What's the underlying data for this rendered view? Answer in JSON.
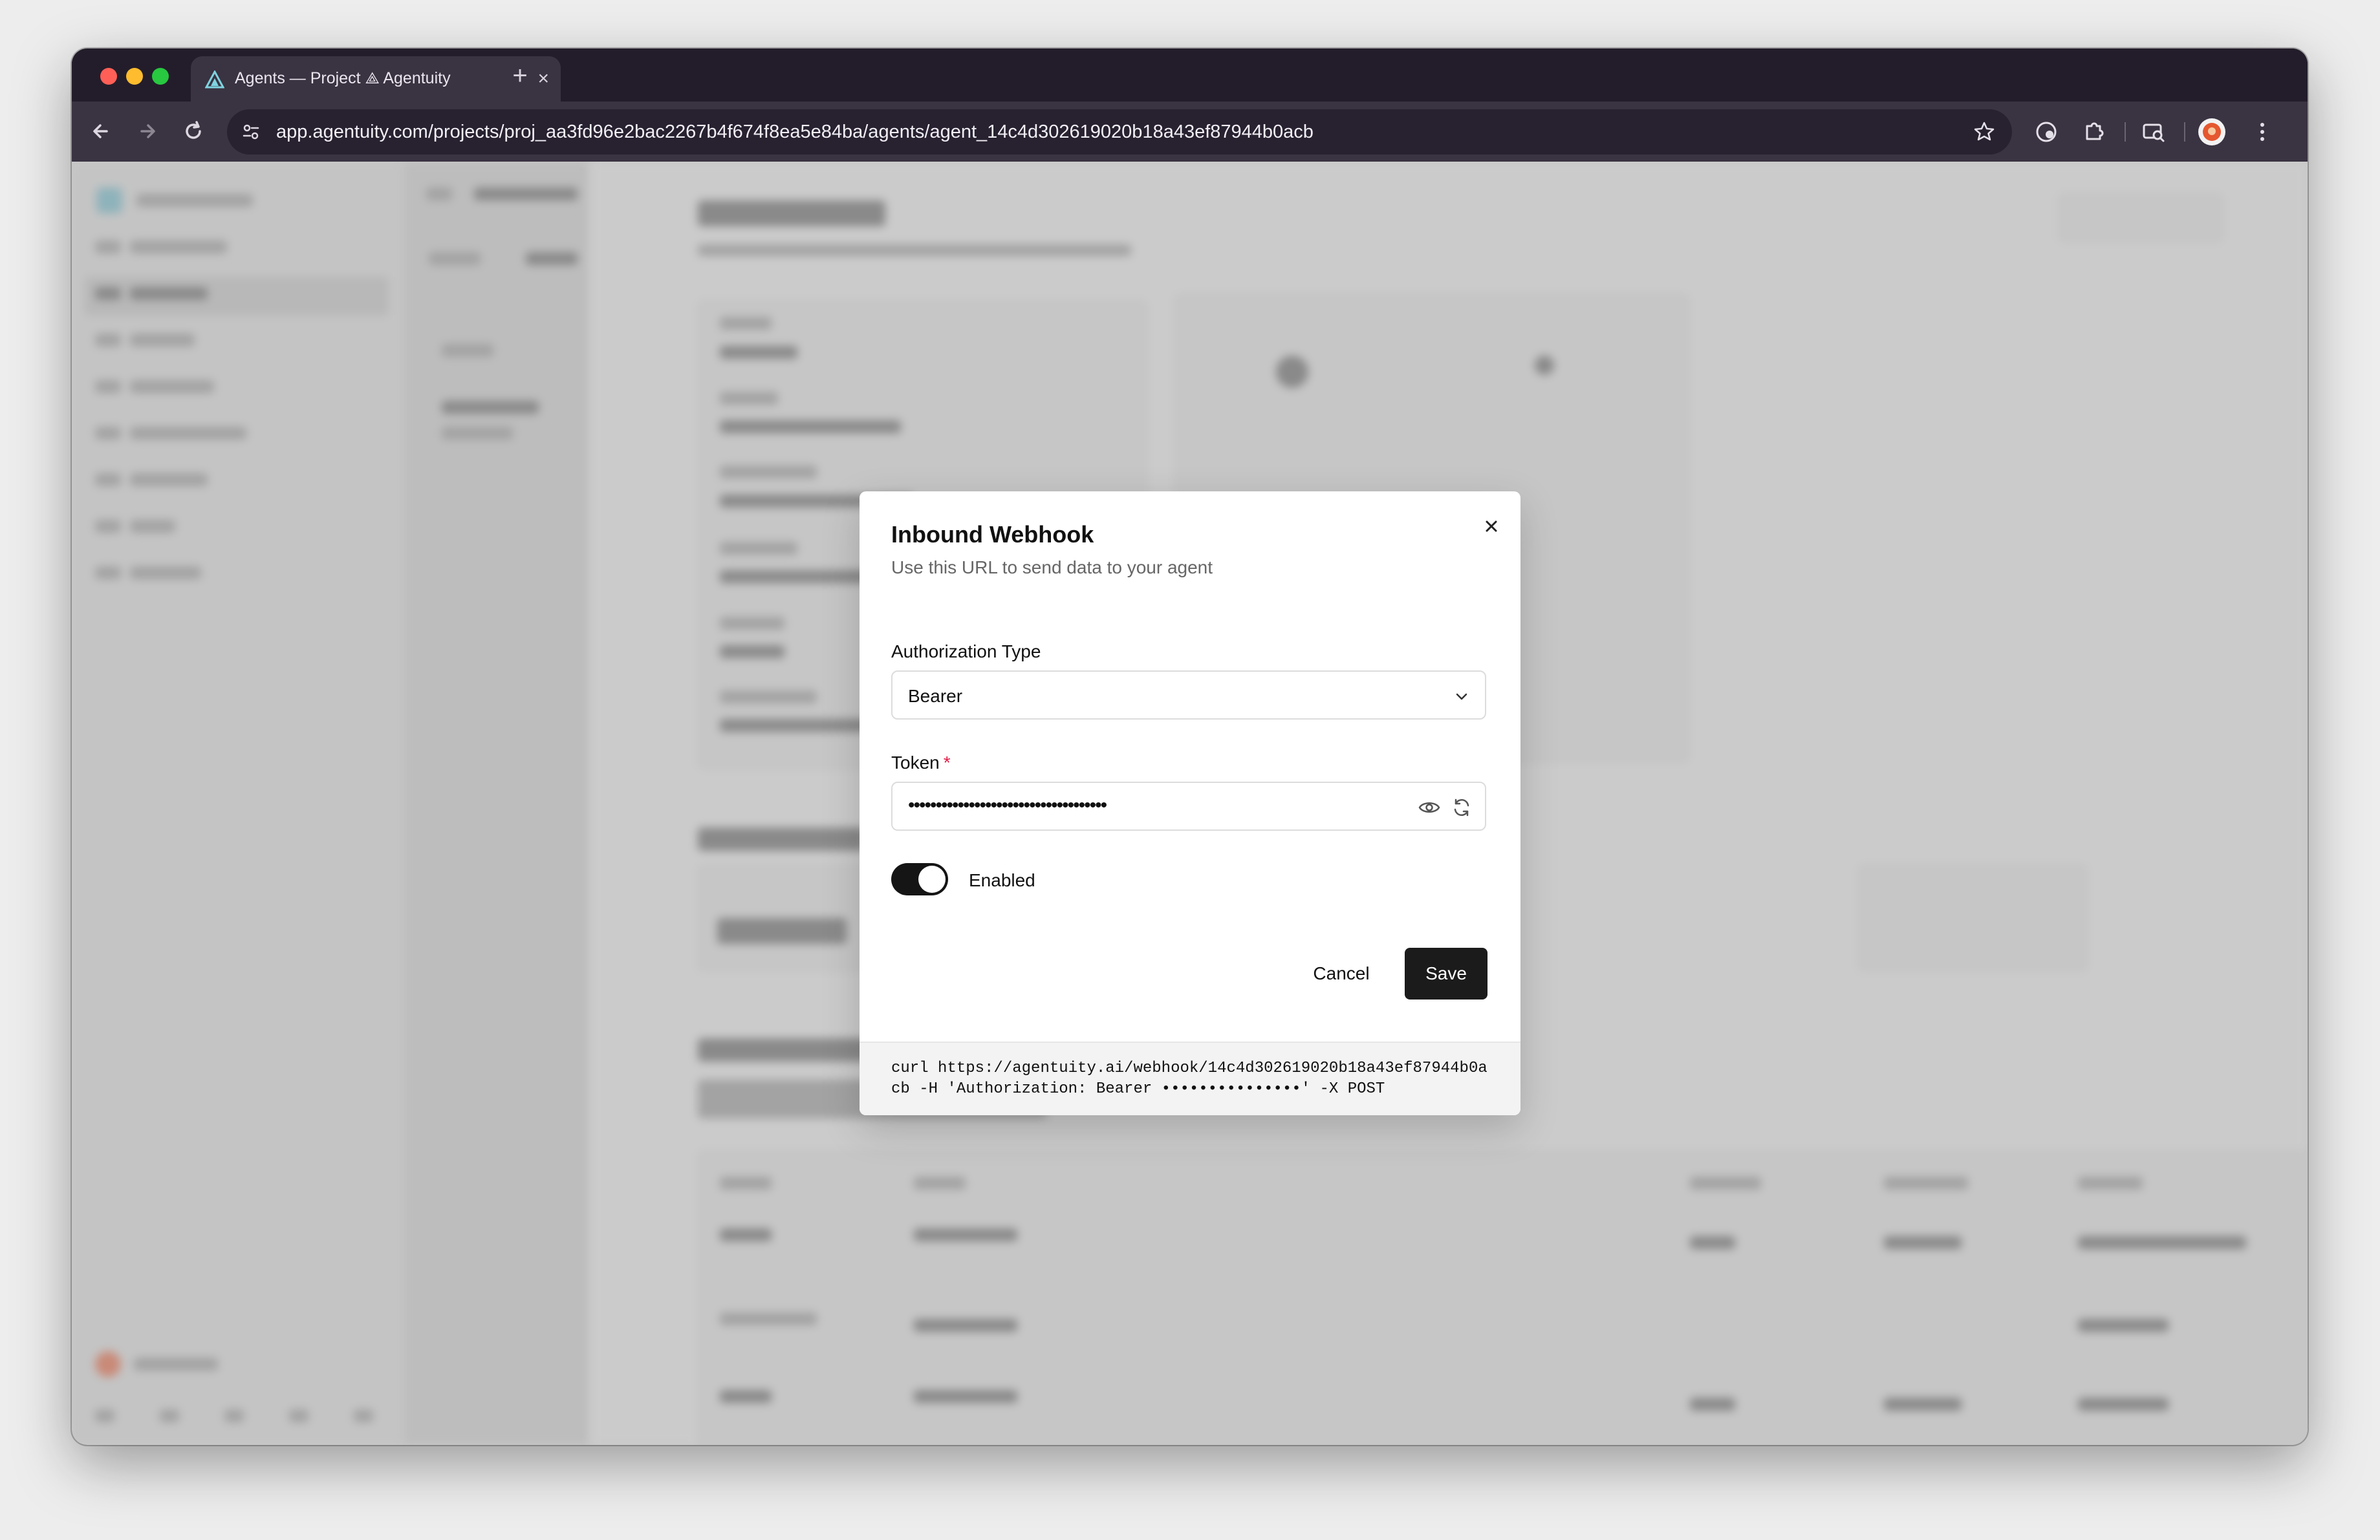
{
  "browser": {
    "tab_title": "Agents — Project ⟁ Agentuity",
    "new_tab": "+",
    "tab_close": "×",
    "url_host": "app.agentuity.com",
    "url_path": "/projects/proj_aa3fd96e2bac2267b4f674f8ea5e84ba/agents/agent_14c4d302619020b18a43ef87944b0acb",
    "icons": [
      "back-icon",
      "forward-icon",
      "reload-icon",
      "site-settings-icon",
      "bookmark-star-icon",
      "extension-icon",
      "puzzle-extensions-icon",
      "search-tabs-icon",
      "profile-avatar-icon",
      "menu-kebab-icon"
    ],
    "colors": {
      "traffic_red": "#ff5f57",
      "traffic_yellow": "#febc2e",
      "traffic_green": "#28c840"
    }
  },
  "modal": {
    "title": "Inbound Webhook",
    "description": "Use this URL to send data to your agent",
    "auth_type_label": "Authorization Type",
    "auth_type_value": "Bearer",
    "token_label": "Token",
    "token_required_mark": "*",
    "token_value": "••••••••••••••••••••••••••••••••••••",
    "enabled_label": "Enabled",
    "enabled": true,
    "cancel_label": "Cancel",
    "save_label": "Save",
    "curl_line1": "curl https://agentuity.ai/webhook/14c4d302619020b18a43ef87944b0a",
    "curl_line2": "cb -H 'Authorization: Bearer •••••••••••••••' -X POST"
  }
}
